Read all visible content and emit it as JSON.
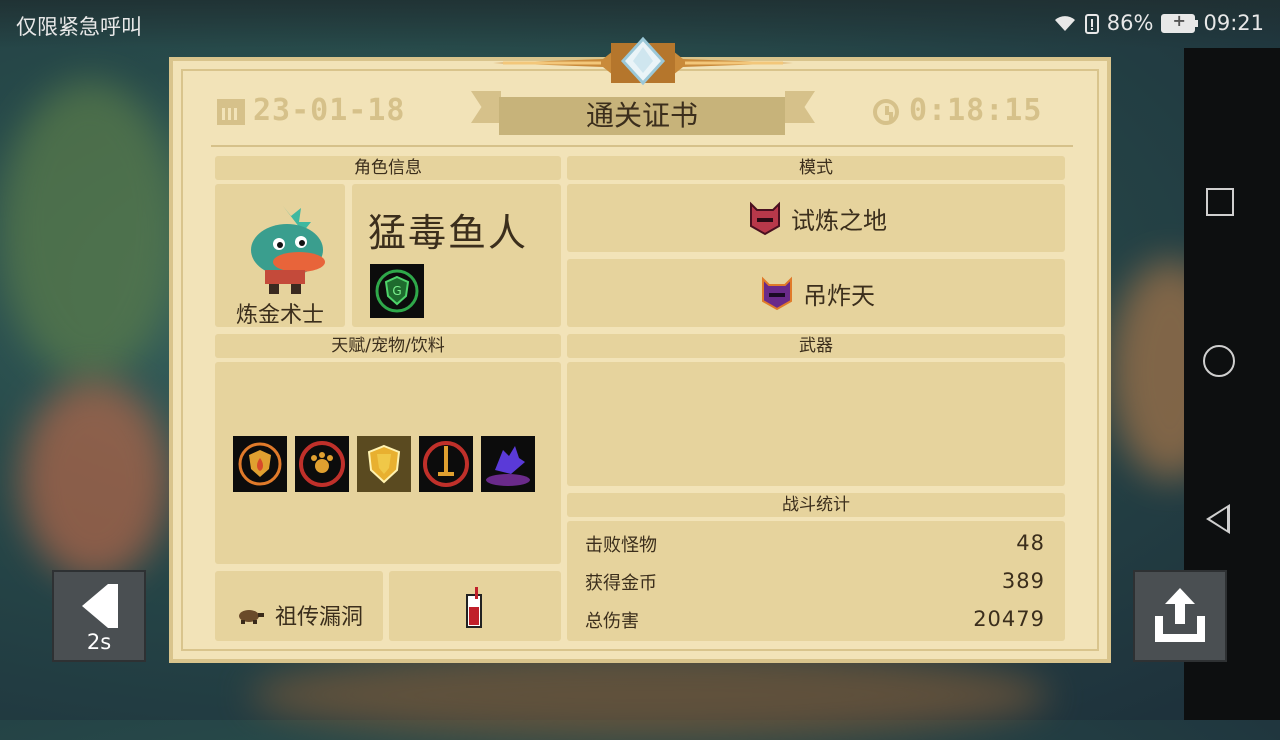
{
  "status_bar": {
    "emergency_text": "仅限紧急呼叫",
    "battery_percent": "86%",
    "time": "09:21"
  },
  "certificate": {
    "date": "23-01-18",
    "title": "通关证书",
    "duration": "0:18:15",
    "sections": {
      "character_info": "角色信息",
      "mode": "模式",
      "talents": "天赋/宠物/饮料",
      "weapon": "武器",
      "battle_stats": "战斗统计"
    },
    "character": {
      "name": "猛毒鱼人",
      "class": "炼金术士"
    },
    "modes": [
      {
        "label": "试炼之地",
        "icon": "red-helmet-icon"
      },
      {
        "label": "吊炸天",
        "icon": "purple-helmet-icon"
      }
    ],
    "heirloom": {
      "label": "祖传漏洞",
      "icon": "turtle-icon"
    },
    "drink_icon": "soda-drink-icon",
    "buff_icons": [
      "fire-shield-icon",
      "paw-shield-icon",
      "golden-shield-icon",
      "sword-ring-icon",
      "purple-hand-icon"
    ],
    "stats": [
      {
        "label": "击败怪物",
        "value": "48"
      },
      {
        "label": "获得金币",
        "value": "389"
      },
      {
        "label": "总伤害",
        "value": "20479"
      }
    ]
  },
  "back_button": {
    "countdown": "2s"
  },
  "colors": {
    "paper": "#f2e3b8",
    "panel": "#e6d39d",
    "accent": "#d6c18a",
    "text": "#3b2e1c"
  }
}
